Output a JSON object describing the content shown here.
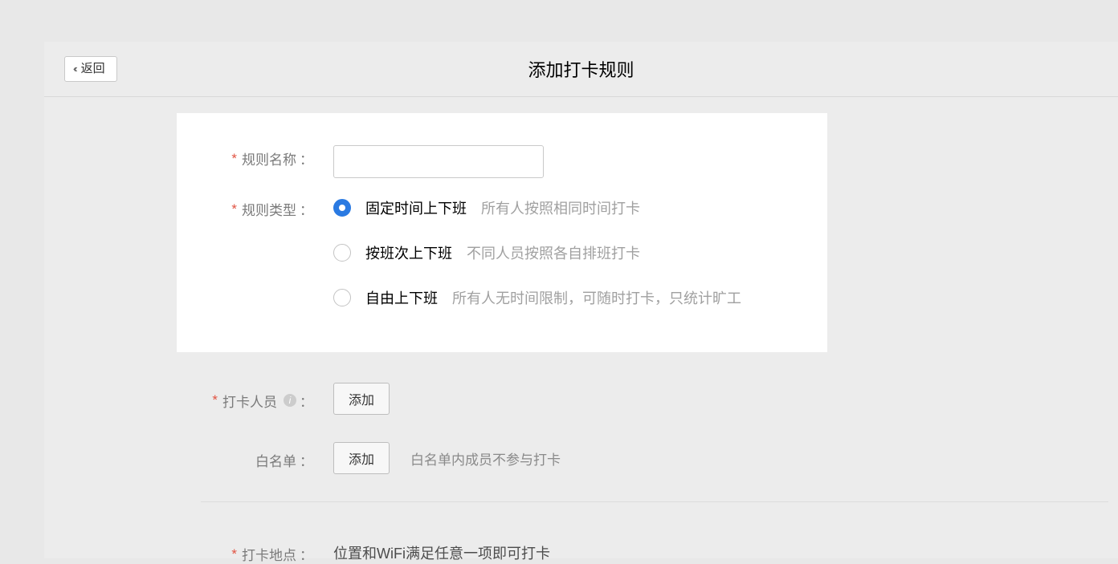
{
  "header": {
    "back_label": "返回",
    "title": "添加打卡规则"
  },
  "form": {
    "rule_name_label": "规则名称",
    "rule_name_value": "",
    "rule_type_label": "规则类型",
    "rule_types": [
      {
        "title": "固定时间上下班",
        "desc": "所有人按照相同时间打卡"
      },
      {
        "title": "按班次上下班",
        "desc": "不同人员按照各自排班打卡"
      },
      {
        "title": "自由上下班",
        "desc": "所有人无时间限制，可随时打卡，只统计旷工"
      }
    ],
    "clock_members_label": "打卡人员",
    "add_button": "添加",
    "whitelist_label": "白名单",
    "whitelist_hint": "白名单内成员不参与打卡",
    "location_label": "打卡地点",
    "location_text": "位置和WiFi满足任意一项即可打卡",
    "colon": "："
  }
}
